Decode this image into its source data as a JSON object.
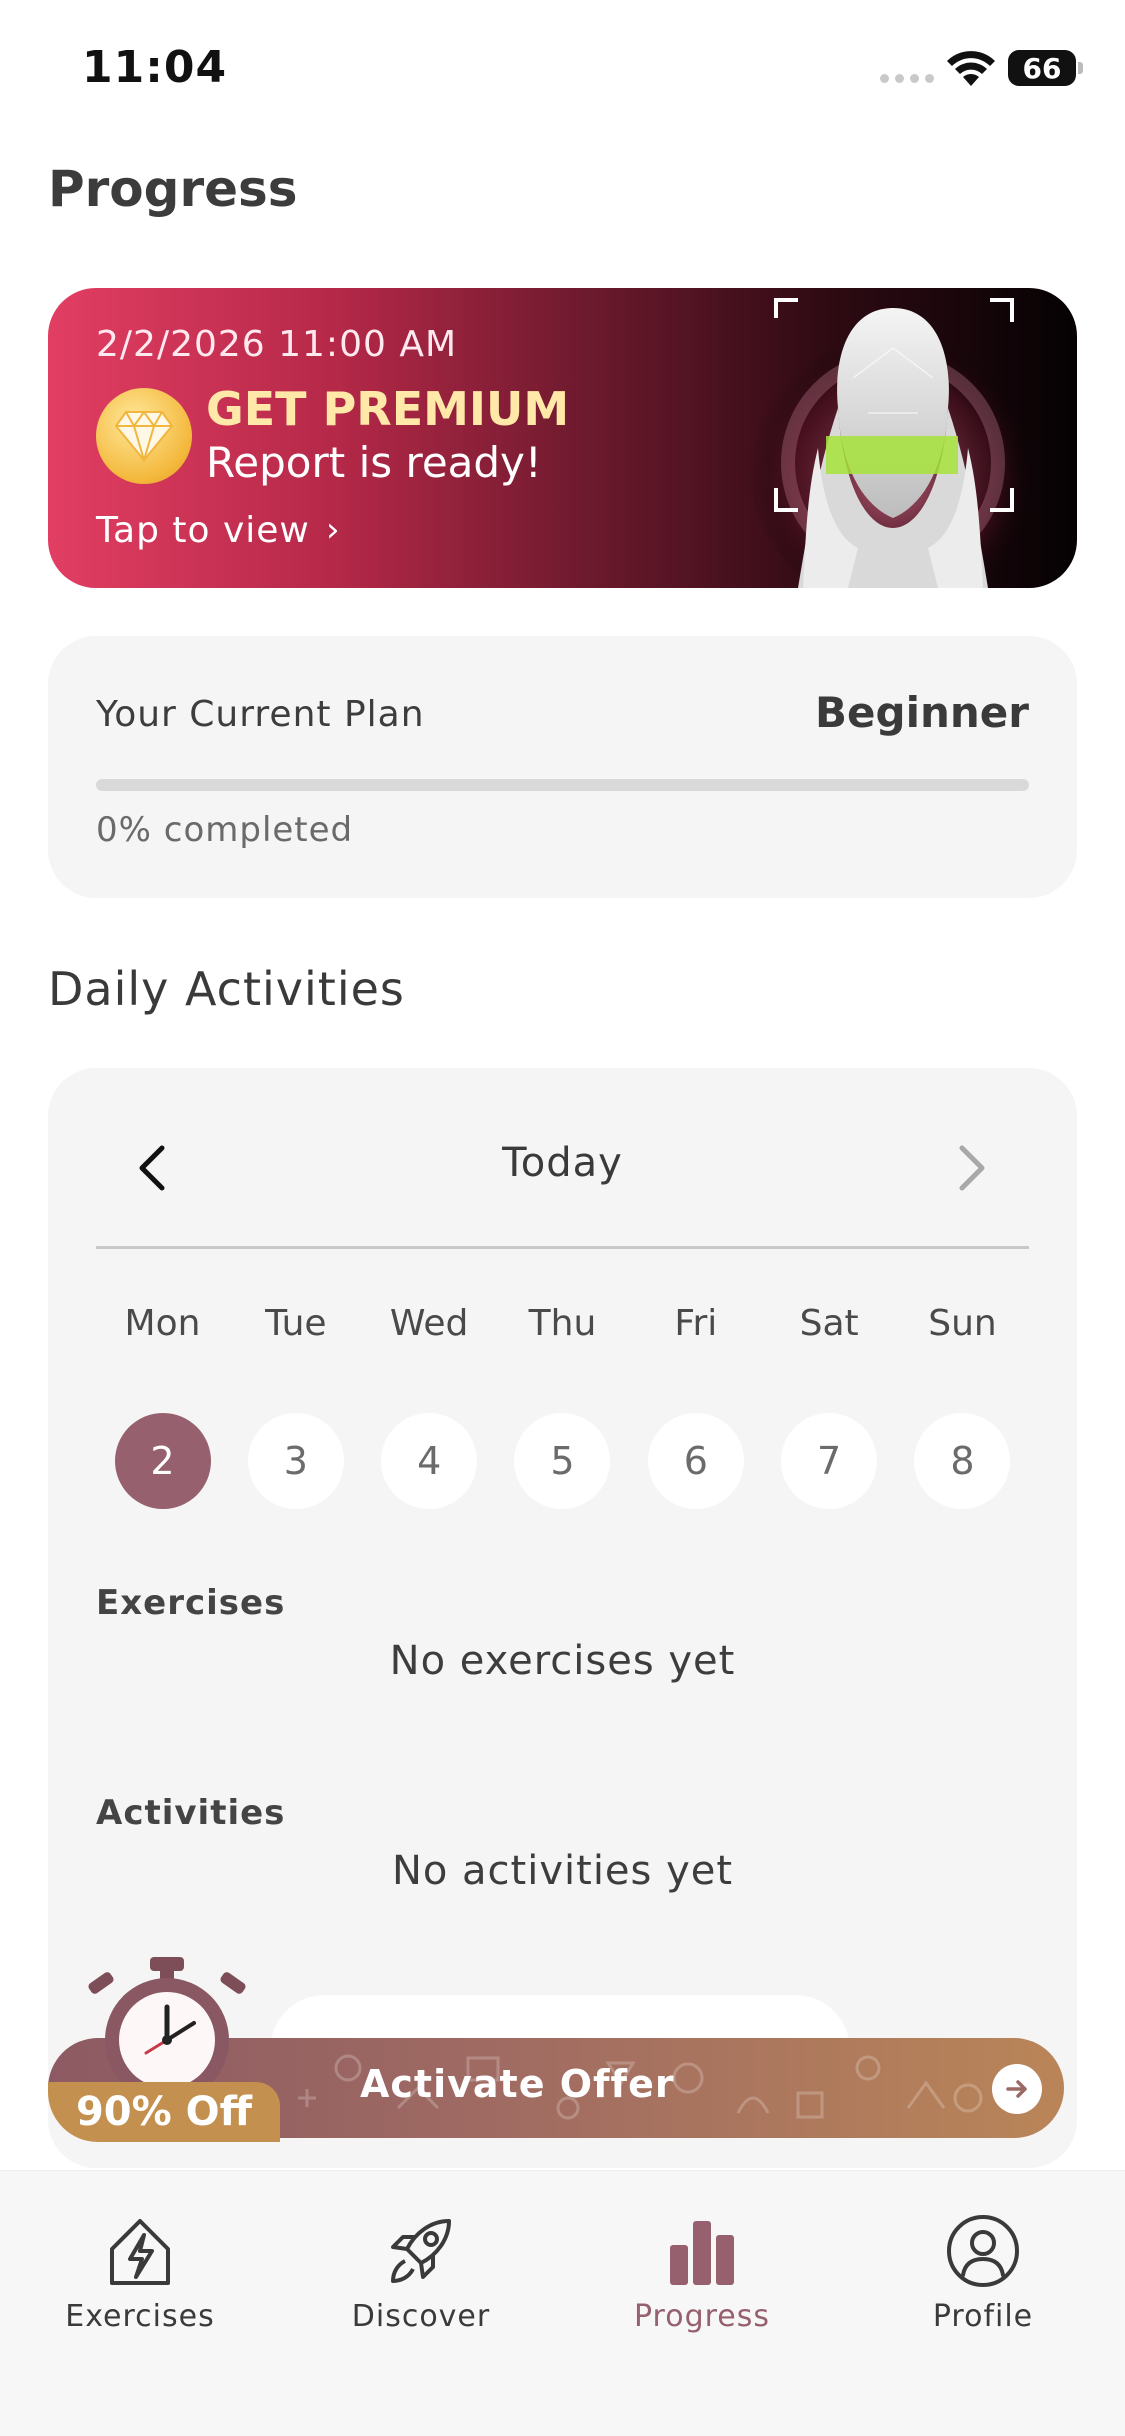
{
  "status_bar": {
    "time": "11:04",
    "battery": "66"
  },
  "page_title": "Progress",
  "premium_banner": {
    "date": "2/2/2026 11:00 AM",
    "title": "GET PREMIUM",
    "subtitle": "Report is ready!",
    "cta": "Tap to view",
    "icon": "diamond-icon"
  },
  "plan": {
    "label": "Your Current Plan",
    "value": "Beginner",
    "progress_text": "0% completed",
    "progress_fraction": 0
  },
  "daily": {
    "title": "Daily Activities",
    "nav_label": "Today",
    "days": [
      {
        "name": "Mon",
        "num": "2",
        "selected": true
      },
      {
        "name": "Tue",
        "num": "3",
        "selected": false
      },
      {
        "name": "Wed",
        "num": "4",
        "selected": false
      },
      {
        "name": "Thu",
        "num": "5",
        "selected": false
      },
      {
        "name": "Fri",
        "num": "6",
        "selected": false
      },
      {
        "name": "Sat",
        "num": "7",
        "selected": false
      },
      {
        "name": "Sun",
        "num": "8",
        "selected": false
      }
    ],
    "exercises_label": "Exercises",
    "exercises_empty": "No exercises yet",
    "activities_label": "Activities",
    "activities_empty": "No activities yet"
  },
  "offer": {
    "discount": "90% Off",
    "label": "Activate Offer"
  },
  "tabs": [
    {
      "label": "Exercises",
      "icon": "exercises-icon",
      "active": false
    },
    {
      "label": "Discover",
      "icon": "rocket-icon",
      "active": false
    },
    {
      "label": "Progress",
      "icon": "bar-chart-icon",
      "active": true
    },
    {
      "label": "Profile",
      "icon": "profile-icon",
      "active": false
    }
  ],
  "colors": {
    "accent": "#96606e",
    "banner_red": "#e23e63",
    "offer_gold": "#c3904f"
  }
}
